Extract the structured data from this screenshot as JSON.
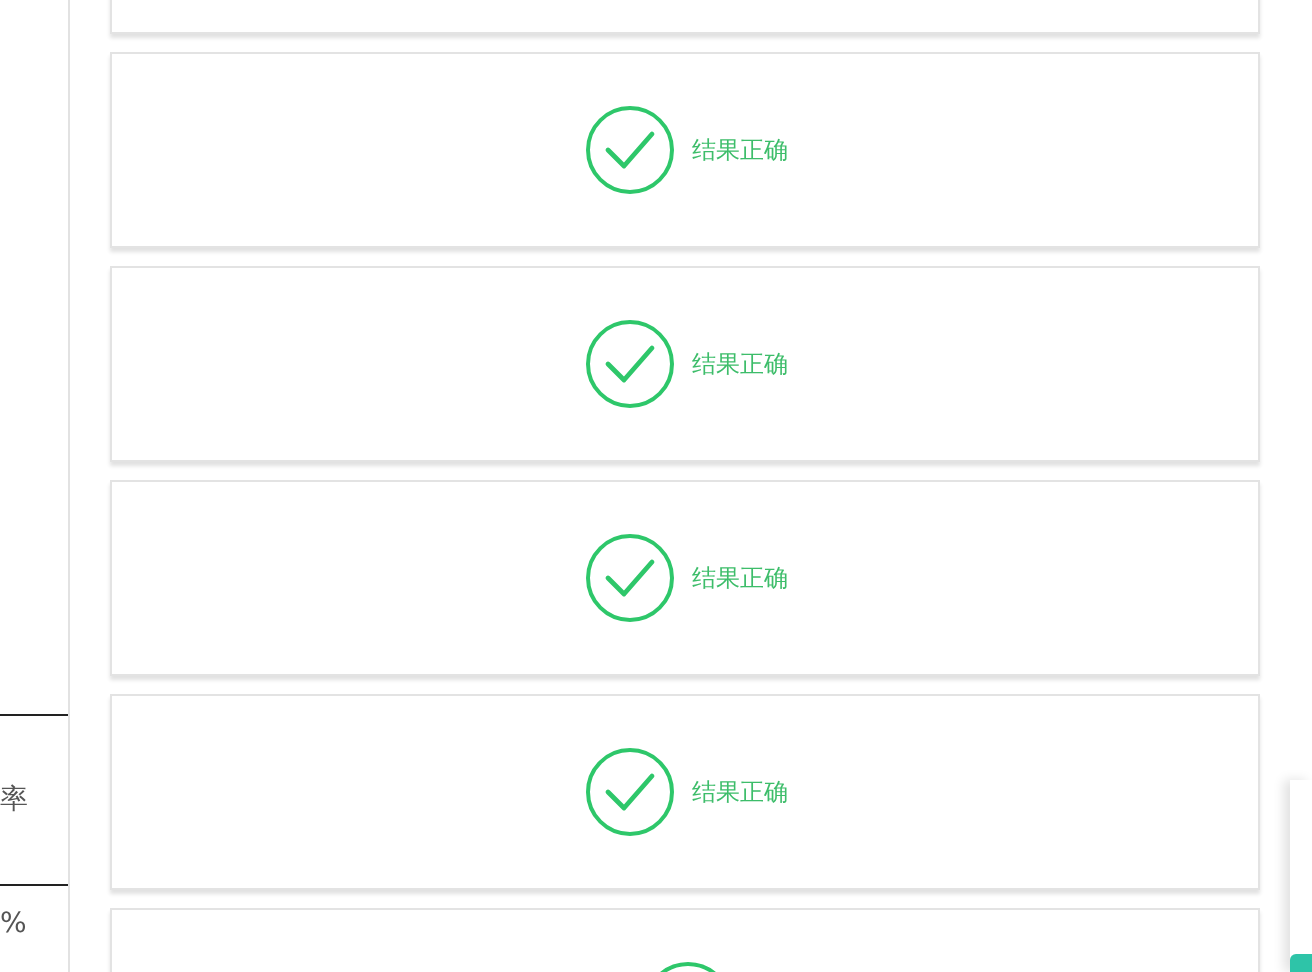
{
  "left_column": {
    "cells": [
      "率",
      "%"
    ]
  },
  "results": [
    {
      "kind": "blank"
    },
    {
      "kind": "correct",
      "label": "结果正确"
    },
    {
      "kind": "correct",
      "label": "结果正确"
    },
    {
      "kind": "correct",
      "label": "结果正确"
    },
    {
      "kind": "correct",
      "label": "结果正确"
    },
    {
      "kind": "correct"
    }
  ]
}
